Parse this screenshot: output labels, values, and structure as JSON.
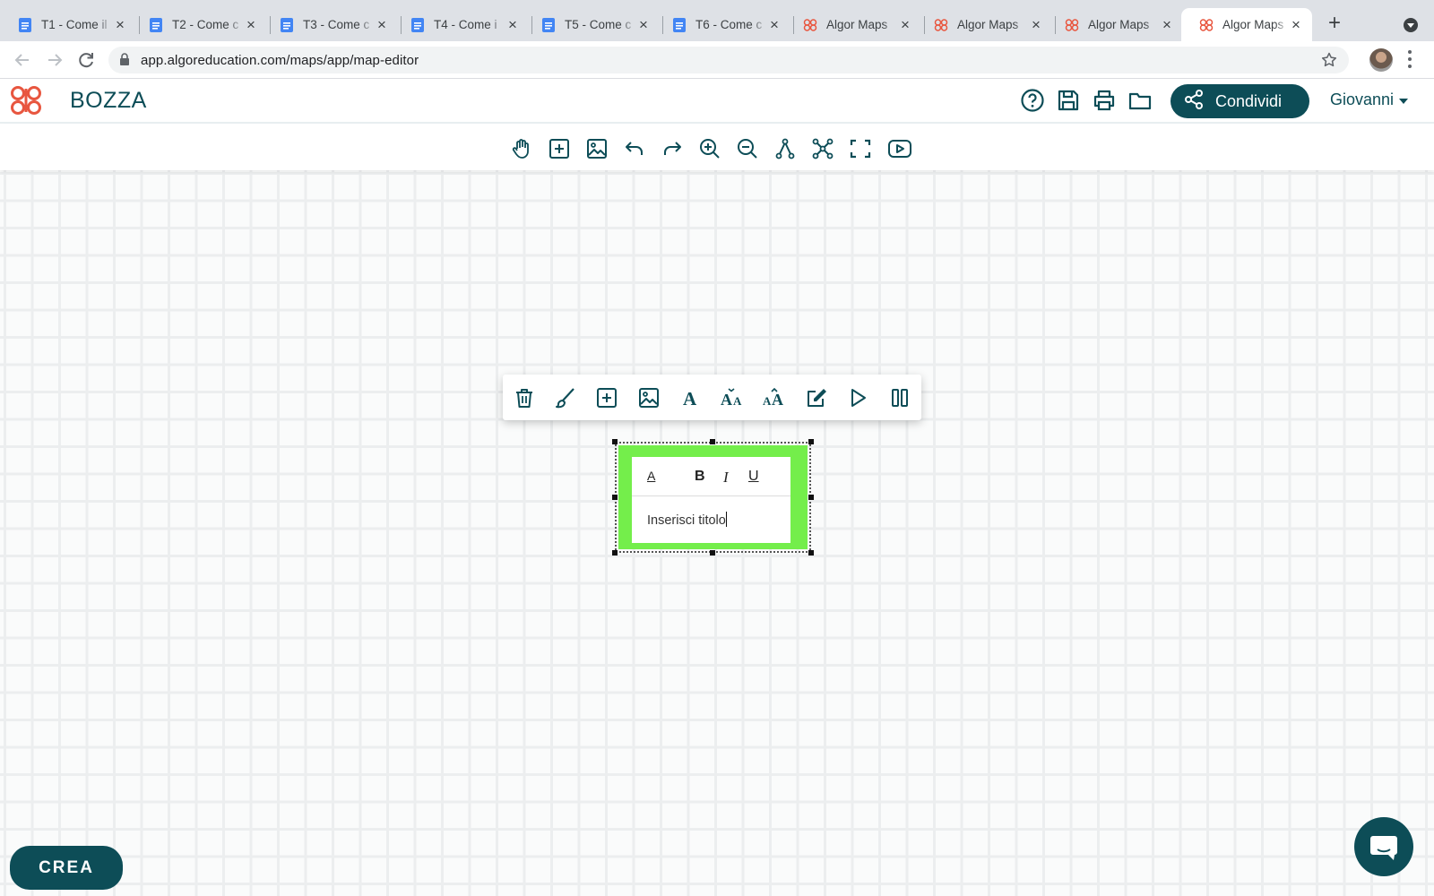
{
  "browser": {
    "tabs": [
      {
        "title": "T1 - Come il",
        "icon": "docs-icon",
        "active": false
      },
      {
        "title": "T2 - Come c",
        "icon": "docs-icon",
        "active": false
      },
      {
        "title": "T3 - Come c",
        "icon": "docs-icon",
        "active": false
      },
      {
        "title": "T4 - Come i",
        "icon": "docs-icon",
        "active": false
      },
      {
        "title": "T5 - Come c",
        "icon": "docs-icon",
        "active": false
      },
      {
        "title": "T6 - Come c",
        "icon": "docs-icon",
        "active": false
      },
      {
        "title": "Algor Maps",
        "icon": "algor-brain-icon",
        "active": false
      },
      {
        "title": "Algor Maps",
        "icon": "algor-brain-icon",
        "active": false
      },
      {
        "title": "Algor Maps",
        "icon": "algor-brain-icon",
        "active": false
      },
      {
        "title": "Algor Maps",
        "icon": "algor-brain-icon",
        "active": true
      }
    ],
    "url": "app.algoreducation.com/maps/app/map-editor"
  },
  "header": {
    "map_title": "BOZZA",
    "share_label": "Condividi",
    "user_name": "Giovanni"
  },
  "node": {
    "text": "Inserisci titolo",
    "format_labels": {
      "text_color": "A",
      "bold": "B",
      "italic": "I",
      "underline": "U"
    }
  },
  "footer": {
    "create_label": "CREA"
  },
  "colors": {
    "brand": "#0d4d57",
    "node_fill": "#74ee4b",
    "logo": "#e8563f"
  }
}
